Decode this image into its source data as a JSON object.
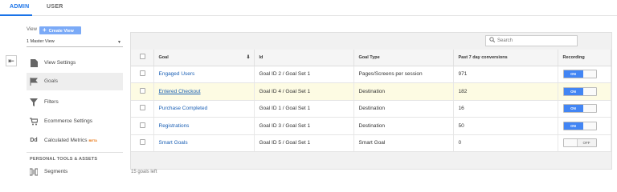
{
  "tabs": [
    {
      "label": "ADMIN",
      "active": true
    },
    {
      "label": "USER",
      "active": false
    }
  ],
  "view": {
    "label": "View",
    "create_label": "Create View",
    "selected": "1 Master View"
  },
  "nav": {
    "items": [
      {
        "label": "View Settings",
        "icon": "document-icon"
      },
      {
        "label": "Goals",
        "icon": "flag-icon"
      },
      {
        "label": "Filters",
        "icon": "filter-icon"
      },
      {
        "label": "Ecommerce Settings",
        "icon": "cart-icon"
      },
      {
        "label": "Calculated Metrics",
        "badge": "BETA",
        "icon": "dd-icon"
      }
    ],
    "section_title": "PERSONAL TOOLS & ASSETS",
    "segments_label": "Segments"
  },
  "search": {
    "placeholder": "Search"
  },
  "table": {
    "headers": [
      "Goal",
      "Id",
      "Goal Type",
      "Past 7 day conversions",
      "Recording"
    ],
    "rows": [
      {
        "goal": "Engaged Users",
        "id": "Goal ID 2 / Goal Set 1",
        "type": "Pages/Screens per session",
        "conversions": "971",
        "recording": "ON"
      },
      {
        "goal": "Entered Checkout",
        "id": "Goal ID 4 / Goal Set 1",
        "type": "Destination",
        "conversions": "182",
        "recording": "ON"
      },
      {
        "goal": "Purchase Completed",
        "id": "Goal ID 1 / Goal Set 1",
        "type": "Destination",
        "conversions": "16",
        "recording": "ON"
      },
      {
        "goal": "Registrations",
        "id": "Goal ID 3 / Goal Set 1",
        "type": "Destination",
        "conversions": "50",
        "recording": "ON"
      },
      {
        "goal": "Smart Goals",
        "id": "Goal ID 5 / Goal Set 1",
        "type": "Smart Goal",
        "conversions": "0",
        "recording": "OFF"
      }
    ]
  },
  "footer": "15 goals left",
  "colors": {
    "accent": "#1a73e8",
    "toggle_on": "#4285f4",
    "highlight_row": "#fdfbe3"
  }
}
